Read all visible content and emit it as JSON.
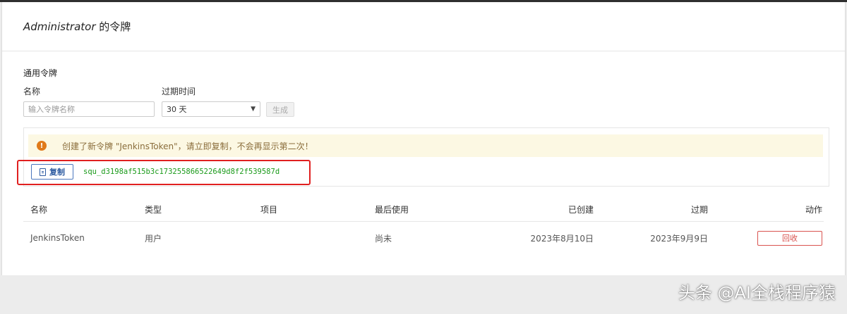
{
  "modal": {
    "title_user": "Administrator",
    "title_suffix": " 的令牌"
  },
  "form": {
    "section_title": "通用令牌",
    "name_label": "名称",
    "name_placeholder": "输入令牌名称",
    "expiry_label": "过期时间",
    "expiry_value": "30 天",
    "generate_label": "生成"
  },
  "token_notice": {
    "alert_text": "创建了新令牌 \"JenkinsToken\"，请立即复制，不会再显示第二次！",
    "copy_label": "复制",
    "token_value": "squ_d3198af515b3c173255866522649d8f2f539587d"
  },
  "table": {
    "headers": {
      "name": "名称",
      "type": "类型",
      "project": "项目",
      "last_used": "最后使用",
      "created": "已创建",
      "expires": "过期",
      "action": "动作"
    },
    "rows": [
      {
        "name": "JenkinsToken",
        "type": "用户",
        "project": "",
        "last_used": "尚未",
        "created": "2023年8月10日",
        "expires": "2023年9月9日",
        "action_label": "回收"
      }
    ]
  },
  "watermark": "头条 @AI全栈程序猿",
  "colors": {
    "alert_bg": "#fcf8e3",
    "alert_text": "#8a6d3b",
    "warning_icon": "#e07a1a",
    "token_text": "#1a9a1a",
    "copy_button": "#2c5aa0",
    "revoke_button": "#d9534f",
    "highlight": "#e02020"
  }
}
